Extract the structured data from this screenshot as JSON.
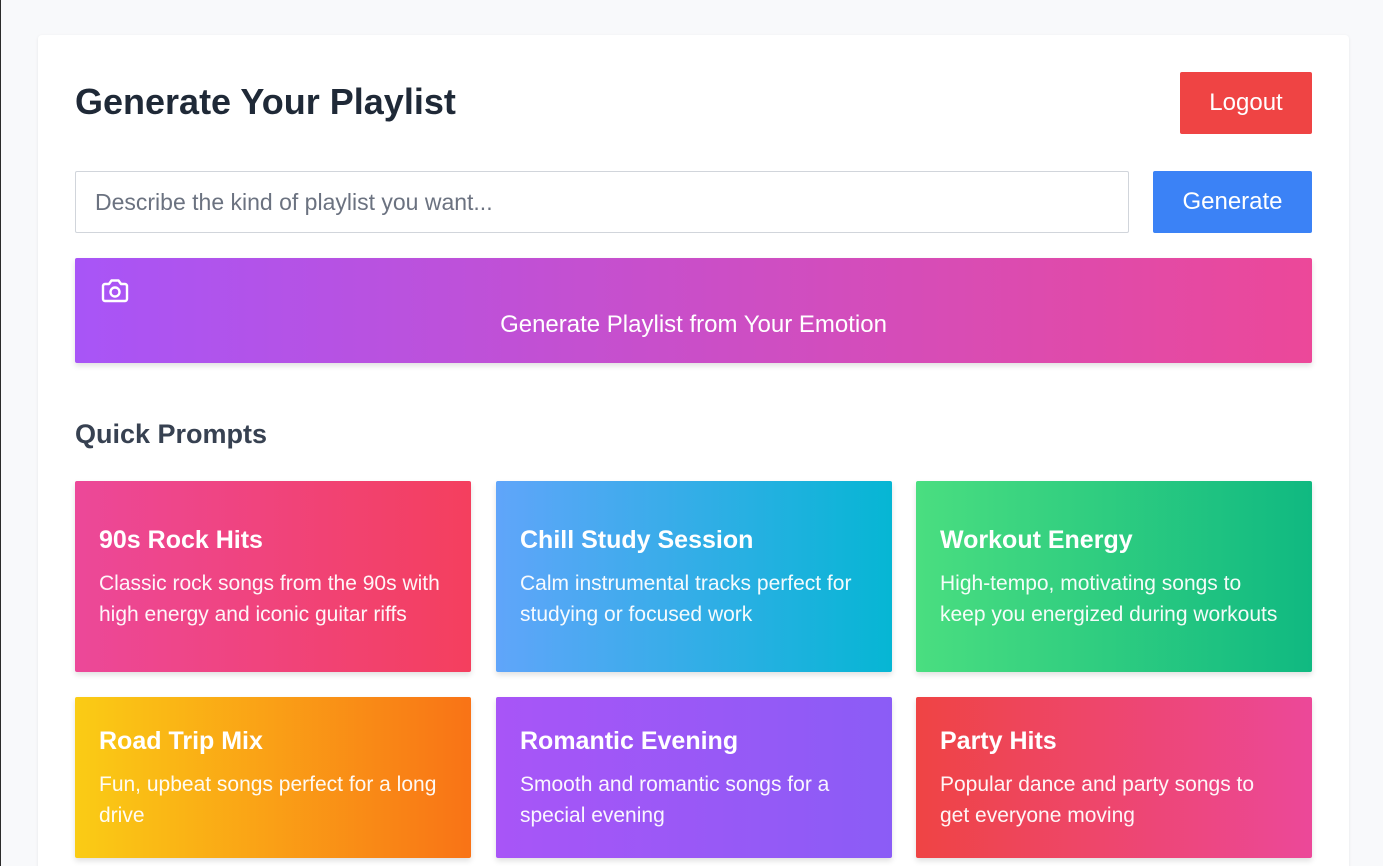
{
  "header": {
    "title": "Generate Your Playlist",
    "logout_label": "Logout"
  },
  "search": {
    "placeholder": "Describe the kind of playlist you want...",
    "value": "",
    "generate_label": "Generate"
  },
  "emotion": {
    "label": "Generate Playlist from Your Emotion",
    "icon": "camera-icon"
  },
  "quick_prompts": {
    "heading": "Quick Prompts",
    "items": [
      {
        "title": "90s Rock Hits",
        "description": "Classic rock songs from the 90s with high energy and iconic guitar riffs",
        "gradient": [
          "#ec4899",
          "#f43f5e"
        ]
      },
      {
        "title": "Chill Study Session",
        "description": "Calm instrumental tracks perfect for studying or focused work",
        "gradient": [
          "#60a5fa",
          "#06b6d4"
        ]
      },
      {
        "title": "Workout Energy",
        "description": "High-tempo, motivating songs to keep you energized during workouts",
        "gradient": [
          "#4ade80",
          "#10b981"
        ]
      },
      {
        "title": "Road Trip Mix",
        "description": "Fun, upbeat songs perfect for a long drive",
        "gradient": [
          "#facc15",
          "#f97316"
        ]
      },
      {
        "title": "Romantic Evening",
        "description": "Smooth and romantic songs for a special evening",
        "gradient": [
          "#a855f7",
          "#8b5cf6"
        ]
      },
      {
        "title": "Party Hits",
        "description": "Popular dance and party songs to get everyone moving",
        "gradient": [
          "#ef4444",
          "#ec4899"
        ]
      }
    ]
  },
  "colors": {
    "logout": "#ef4444",
    "generate": "#3b82f6",
    "emotion_gradient": [
      "#a855f7",
      "#ec4899"
    ]
  }
}
